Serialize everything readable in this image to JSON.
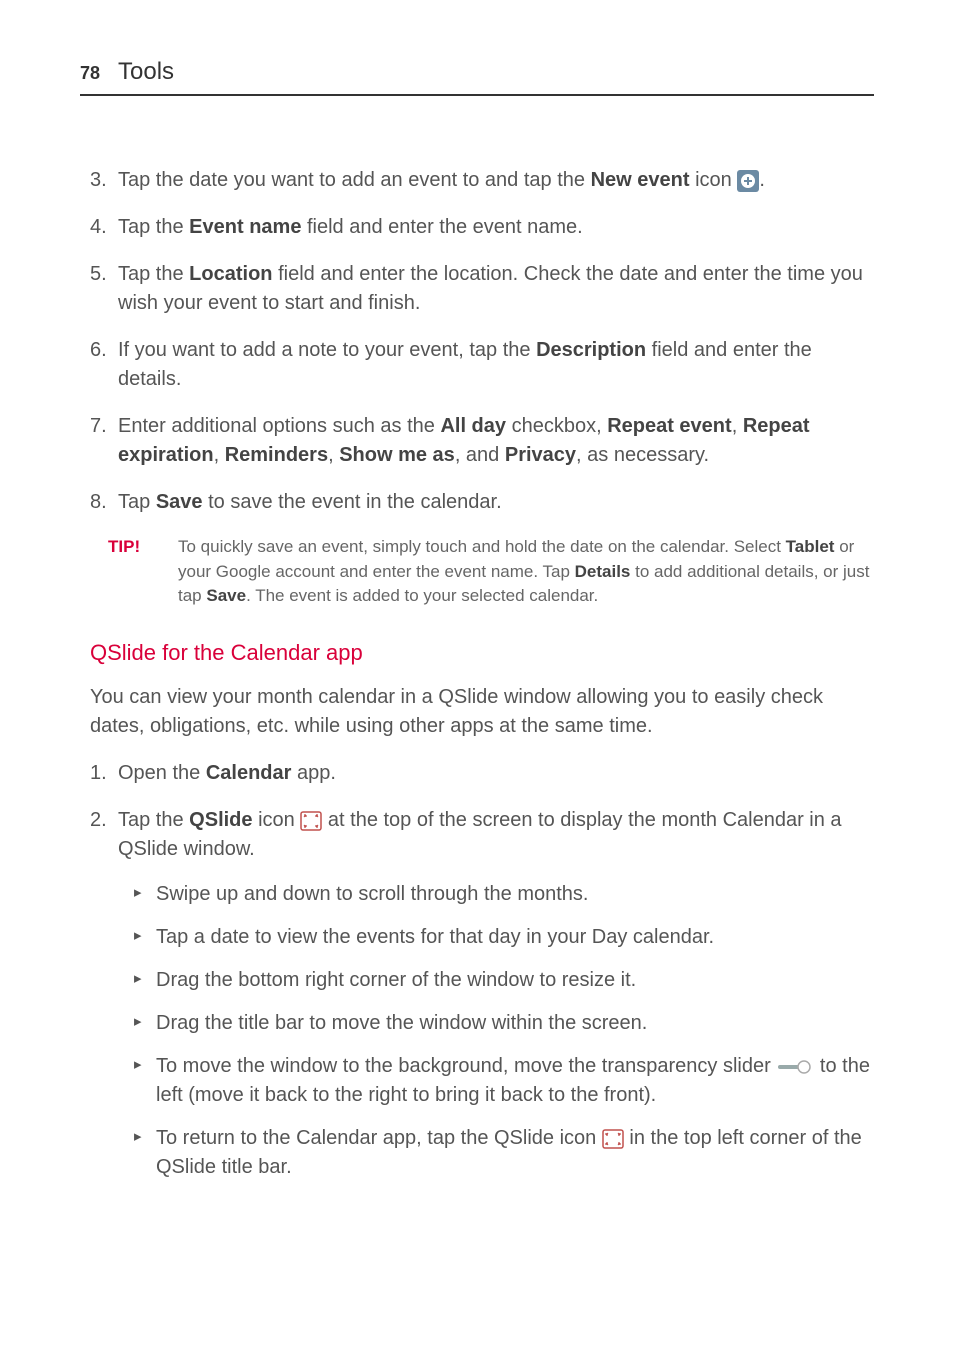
{
  "header": {
    "page_number": "78",
    "section": "Tools"
  },
  "steps": {
    "s3": {
      "num": "3.",
      "a": "Tap the date you want to add an event to and tap the ",
      "bold": "New event",
      "b": " icon ",
      "c": "."
    },
    "s4": {
      "num": "4.",
      "a": "Tap the ",
      "bold": "Event name",
      "b": " field and enter the event name."
    },
    "s5": {
      "num": "5.",
      "a": "Tap the ",
      "bold": "Location",
      "b": " field and enter the location. Check the date and enter the time you wish your event to start and finish."
    },
    "s6": {
      "num": "6.",
      "a": "If you want to add a note to your event, tap the ",
      "bold": "Description",
      "b": " field and enter the details."
    },
    "s7": {
      "num": "7.",
      "a": "Enter additional options such as the ",
      "b1": "All day",
      "t1": " checkbox, ",
      "b2": "Repeat event",
      "t2": ", ",
      "b3": "Repeat expiration",
      "t3": ", ",
      "b4": "Reminders",
      "t4": ", ",
      "b5": "Show me as",
      "t5": ", and ",
      "b6": "Privacy",
      "t6": ", as necessary."
    },
    "s8": {
      "num": "8.",
      "a": "Tap ",
      "bold": "Save",
      "b": " to save the event in the calendar."
    }
  },
  "tip": {
    "label": "TIP!",
    "a": "To quickly save an event, simply touch and hold the date on the calendar. Select ",
    "b1": "Tablet",
    "t1": " or your Google account and enter the event name. Tap ",
    "b2": "Details",
    "t2": " to add additional details, or just tap ",
    "b3": "Save",
    "t3": ". The event is added to your selected calendar."
  },
  "qslide": {
    "heading": "QSlide for the Calendar app",
    "intro": "You can view your month calendar in a QSlide window allowing you to easily check dates, obligations, etc. while using other apps at the same time.",
    "step1": {
      "num": "1.",
      "a": "Open the ",
      "bold": "Calendar",
      "b": " app."
    },
    "step2": {
      "num": "2.",
      "a": "Tap the ",
      "bold": "QSlide",
      "b": " icon ",
      "c": " at the top of the screen to display the month Calendar in a QSlide window."
    },
    "bullets": {
      "b1": "Swipe up and down to scroll through the months.",
      "b2": "Tap a date to view the events for that day in your Day calendar.",
      "b3": "Drag the bottom right corner of the window to resize it.",
      "b4": "Drag the title bar to move the window within the screen.",
      "b5a": "To move the window to the background, move the transparency slider ",
      "b5b": " to the left (move it back to the right to bring it back to the front).",
      "b6a": "To return to the Calendar app, tap the QSlide icon ",
      "b6b": " in the top left corner of the QSlide title bar."
    }
  }
}
